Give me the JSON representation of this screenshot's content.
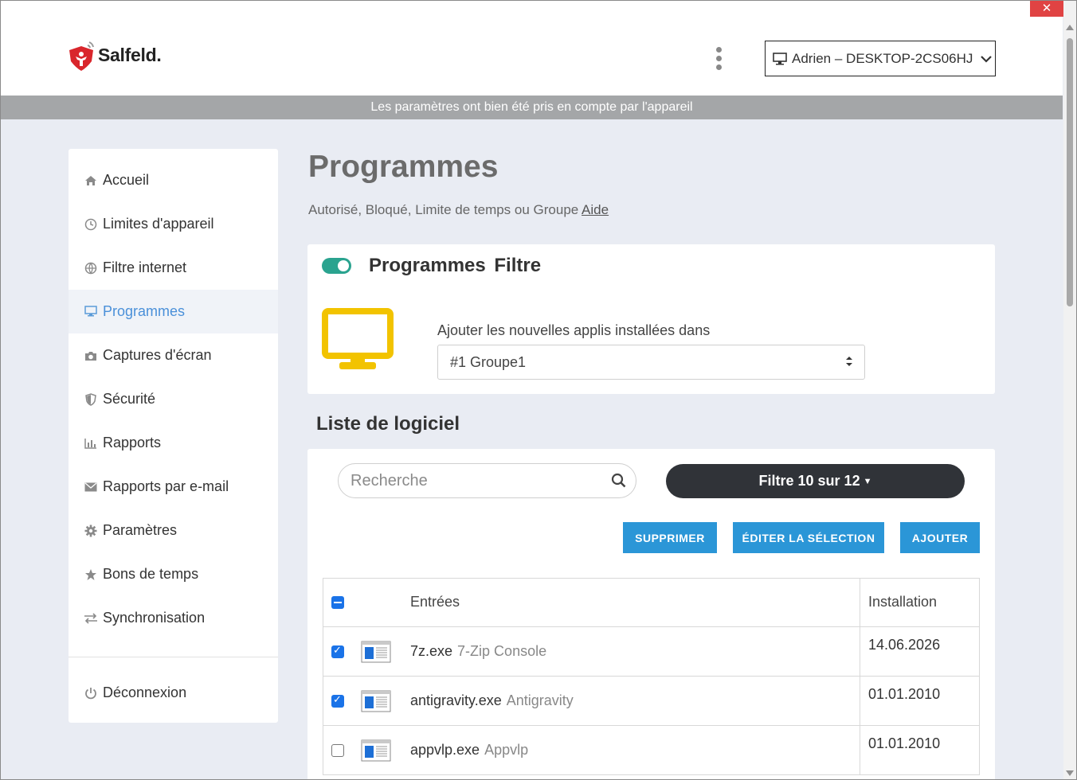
{
  "window": {
    "close_glyph": "✕"
  },
  "header": {
    "logo_text": "Salfeld.",
    "device_label": "Adrien – DESKTOP-2CS06HJ"
  },
  "banner": {
    "text": "Les paramètres ont bien été pris en compte par l'appareil"
  },
  "sidebar": {
    "items": [
      {
        "label": "Accueil",
        "icon": "home-icon"
      },
      {
        "label": "Limites d'appareil",
        "icon": "clock-icon"
      },
      {
        "label": "Filtre internet",
        "icon": "globe-icon"
      },
      {
        "label": "Programmes",
        "icon": "monitor-icon",
        "active": true
      },
      {
        "label": "Captures d'écran",
        "icon": "camera-icon"
      },
      {
        "label": "Sécurité",
        "icon": "shield-icon"
      },
      {
        "label": "Rapports",
        "icon": "bar-chart-icon"
      },
      {
        "label": "Rapports par e-mail",
        "icon": "envelope-icon"
      },
      {
        "label": "Paramètres",
        "icon": "gear-icon"
      },
      {
        "label": "Bons de temps",
        "icon": "star-icon"
      },
      {
        "label": "Synchronisation",
        "icon": "sync-arrows-icon"
      }
    ],
    "logout": {
      "label": "Déconnexion",
      "icon": "power-icon"
    }
  },
  "main": {
    "title": "Programmes",
    "subtitle": "Autorisé, Bloqué, Limite de temps ou Groupe",
    "help_link": "Aide",
    "filter_card": {
      "title": "Programmes Filtre",
      "toggle_on": true,
      "add_label": "Ajouter les nouvelles applis installées dans",
      "group_value": "#1 Groupe1"
    },
    "list_title": "Liste de logiciel",
    "search": {
      "placeholder": "Recherche"
    },
    "filter_button": "Filtre 10 sur 12",
    "buttons": {
      "delete": "SUPPRIMER",
      "edit": "ÉDITER LA SÉLECTION",
      "add": "AJOUTER"
    },
    "table": {
      "headers": {
        "entries": "Entrées",
        "installation": "Installation"
      },
      "rows": [
        {
          "exe": "7z.exe",
          "desc": "7-Zip Console",
          "date": "14.06.2026",
          "checked": true
        },
        {
          "exe": "antigravity.exe",
          "desc": "Antigravity",
          "date": "01.01.2010",
          "checked": true
        },
        {
          "exe": "appvlp.exe",
          "desc": "Appvlp",
          "date": "01.01.2010",
          "checked": false
        }
      ]
    }
  },
  "colors": {
    "accent": "#2b96d7",
    "toggle": "#2aa38f",
    "monitor_yellow": "#f2c300",
    "active_nav": "#4a90d9",
    "banner": "#a4a6a8"
  }
}
